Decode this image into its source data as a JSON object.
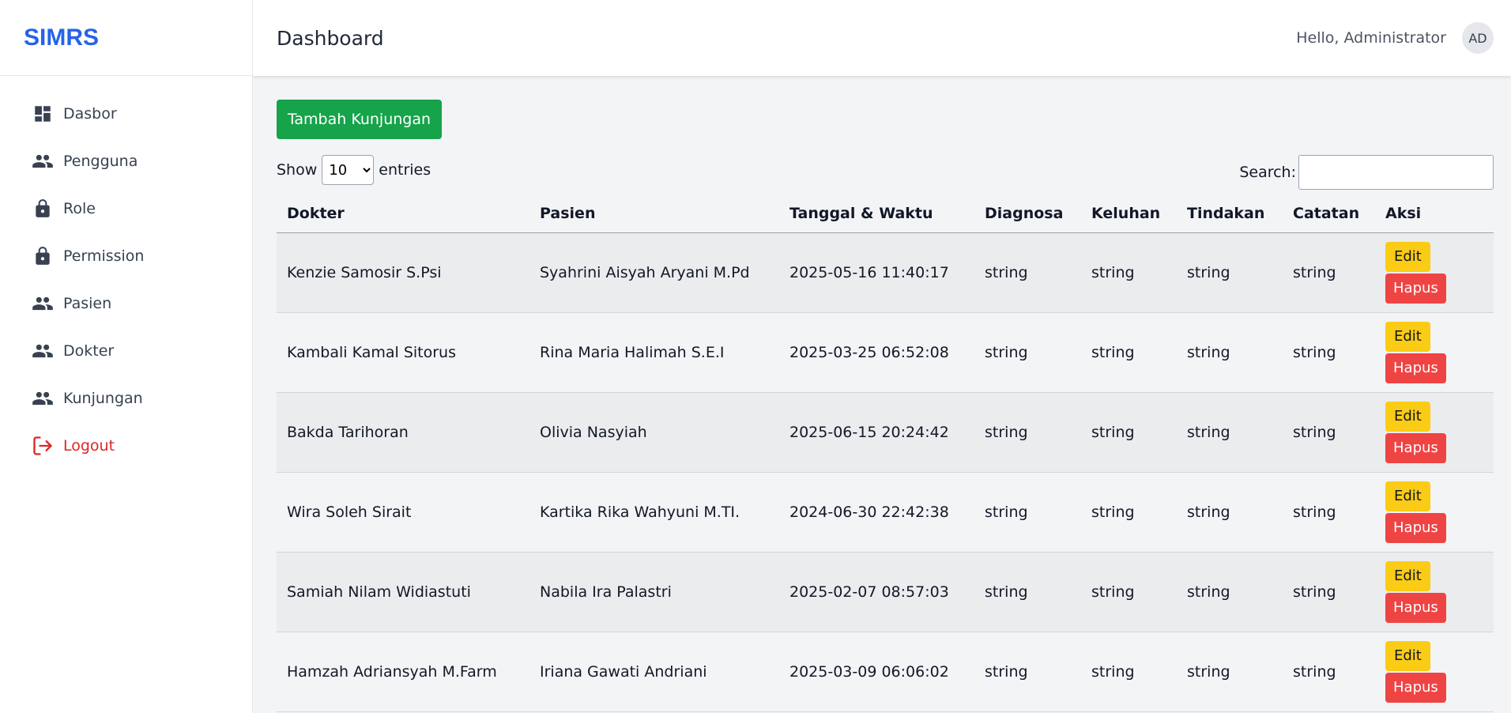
{
  "brand": "SIMRS",
  "sidebar": {
    "items": [
      {
        "label": "Dasbor",
        "icon": "dashboard-icon"
      },
      {
        "label": "Pengguna",
        "icon": "users-icon"
      },
      {
        "label": "Role",
        "icon": "lock-icon"
      },
      {
        "label": "Permission",
        "icon": "lock-icon"
      },
      {
        "label": "Pasien",
        "icon": "users-icon"
      },
      {
        "label": "Dokter",
        "icon": "users-icon"
      },
      {
        "label": "Kunjungan",
        "icon": "users-icon"
      },
      {
        "label": "Logout",
        "icon": "logout-icon"
      }
    ]
  },
  "header": {
    "title": "Dashboard",
    "greeting": "Hello, Administrator",
    "avatar": "AD"
  },
  "toolbar": {
    "add_label": "Tambah Kunjungan",
    "show_label": "Show",
    "entries_label": "entries",
    "entries_value": "10",
    "search_label": "Search:"
  },
  "table": {
    "columns": [
      "Dokter",
      "Pasien",
      "Tanggal & Waktu",
      "Diagnosa",
      "Keluhan",
      "Tindakan",
      "Catatan",
      "Aksi"
    ],
    "edit_label": "Edit",
    "delete_label": "Hapus",
    "rows": [
      {
        "dokter": "Kenzie Samosir S.Psi",
        "pasien": "Syahrini Aisyah Aryani M.Pd",
        "waktu": "2025-05-16 11:40:17",
        "diagnosa": "string",
        "keluhan": "string",
        "tindakan": "string",
        "catatan": "string"
      },
      {
        "dokter": "Kambali Kamal Sitorus",
        "pasien": "Rina Maria Halimah S.E.I",
        "waktu": "2025-03-25 06:52:08",
        "diagnosa": "string",
        "keluhan": "string",
        "tindakan": "string",
        "catatan": "string"
      },
      {
        "dokter": "Bakda Tarihoran",
        "pasien": "Olivia Nasyiah",
        "waktu": "2025-06-15 20:24:42",
        "diagnosa": "string",
        "keluhan": "string",
        "tindakan": "string",
        "catatan": "string"
      },
      {
        "dokter": "Wira Soleh Sirait",
        "pasien": "Kartika Rika Wahyuni M.TI.",
        "waktu": "2024-06-30 22:42:38",
        "diagnosa": "string",
        "keluhan": "string",
        "tindakan": "string",
        "catatan": "string"
      },
      {
        "dokter": "Samiah Nilam Widiastuti",
        "pasien": "Nabila Ira Palastri",
        "waktu": "2025-02-07 08:57:03",
        "diagnosa": "string",
        "keluhan": "string",
        "tindakan": "string",
        "catatan": "string"
      },
      {
        "dokter": "Hamzah Adriansyah M.Farm",
        "pasien": "Iriana Gawati Andriani",
        "waktu": "2025-03-09 06:06:02",
        "diagnosa": "string",
        "keluhan": "string",
        "tindakan": "string",
        "catatan": "string"
      }
    ]
  },
  "colors": {
    "brand": "#2563eb",
    "add_button": "#16a34a",
    "edit_button": "#facc15",
    "delete_button": "#ef4444",
    "logout": "#dc2626"
  }
}
